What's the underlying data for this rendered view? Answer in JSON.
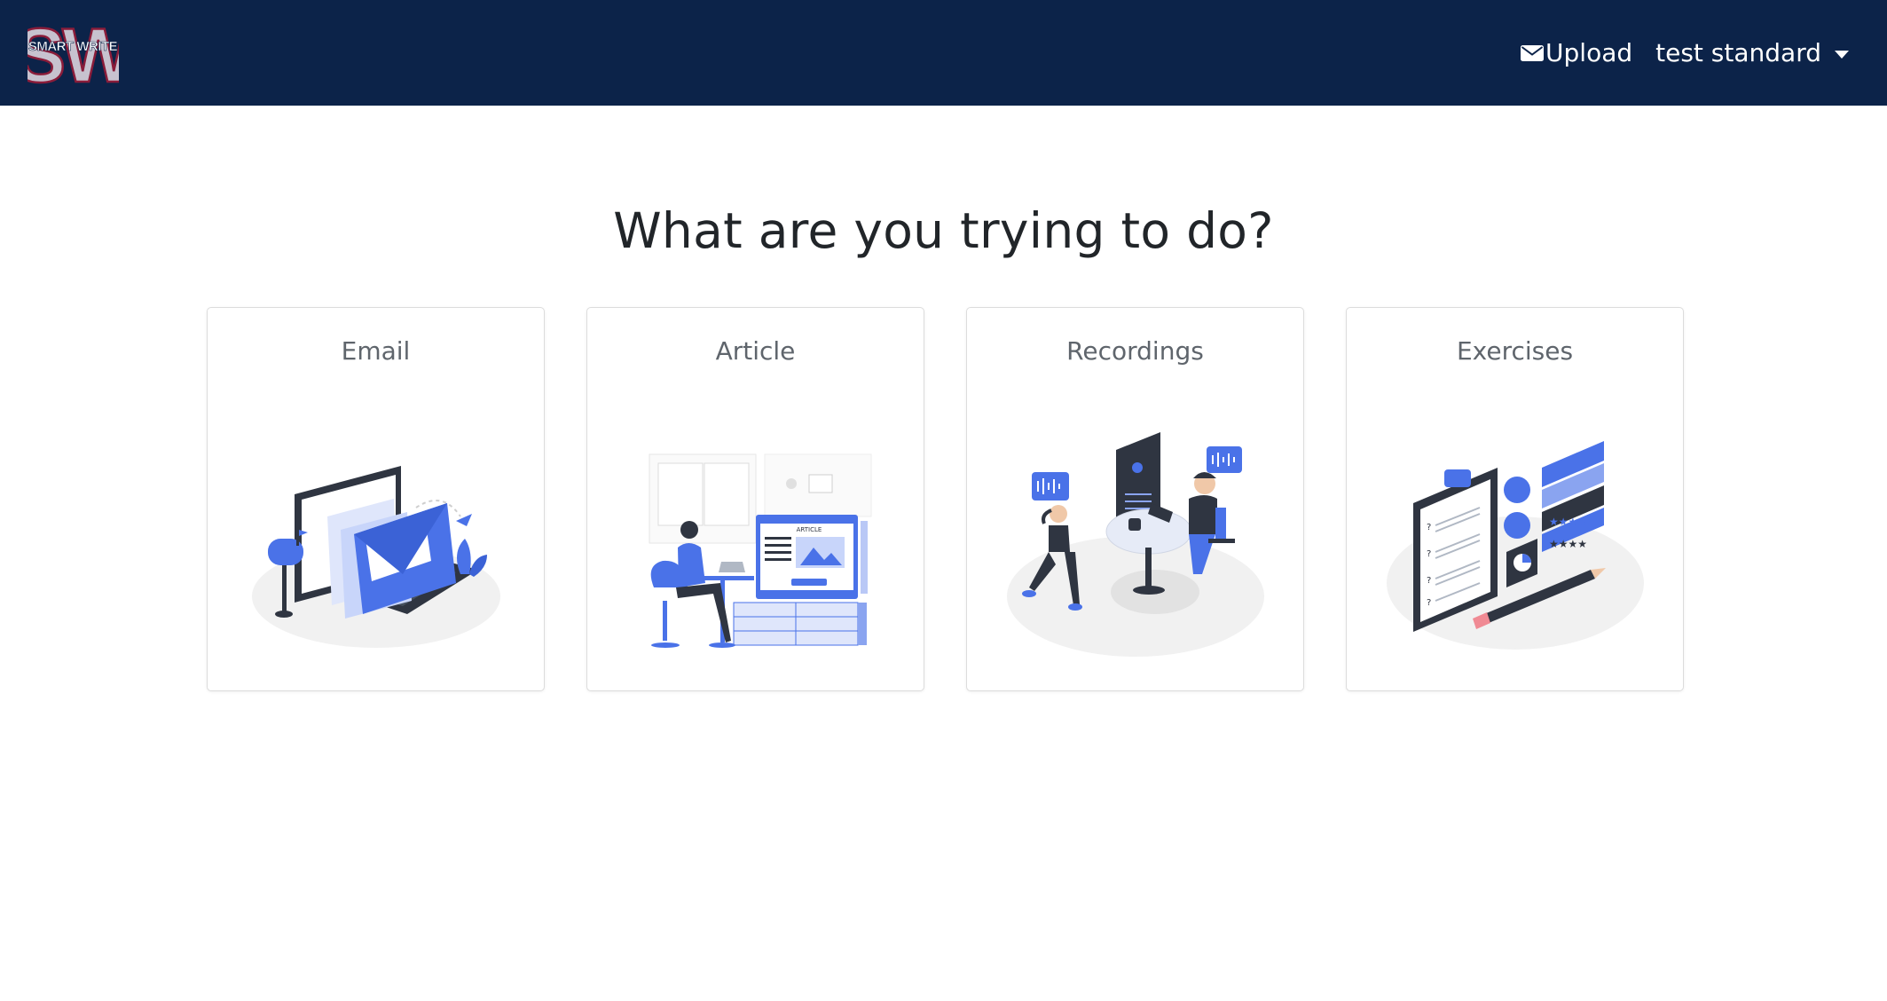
{
  "app": {
    "logo_text": "SMART WRITE",
    "logo_initials": "SW"
  },
  "navbar": {
    "upload_label": "Upload",
    "user_label": "test standard",
    "upload_icon": "envelope-icon"
  },
  "main": {
    "heading": "What are you trying to do?",
    "options": [
      {
        "label": "Email",
        "icon": "email-illustration"
      },
      {
        "label": "Article",
        "icon": "article-illustration"
      },
      {
        "label": "Recordings",
        "icon": "recordings-illustration"
      },
      {
        "label": "Exercises",
        "icon": "exercises-illustration"
      }
    ]
  },
  "colors": {
    "navbar_bg": "#0c2349",
    "accent": "#4a72e8",
    "card_border": "#dcdcdc"
  }
}
